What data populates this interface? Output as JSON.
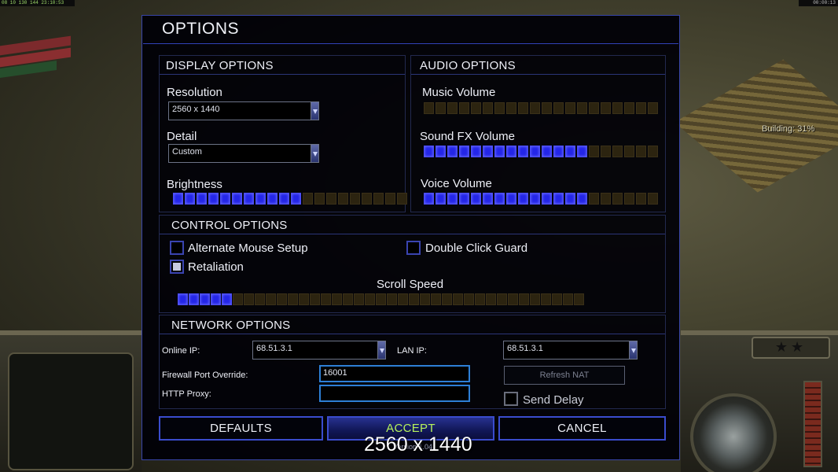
{
  "hud": {
    "top_left_text": "08 10 130 144 23:10:53",
    "top_right_text": "00:00:13",
    "building_text": "Building: 31%"
  },
  "dialog": {
    "title": "OPTIONS",
    "version_text": "Version 1.04"
  },
  "display": {
    "header": "DISPLAY OPTIONS",
    "resolution_label": "Resolution",
    "resolution_value": "2560 x 1440",
    "detail_label": "Detail",
    "detail_value": "Custom",
    "brightness_label": "Brightness",
    "brightness_level": 11,
    "brightness_segments": 20
  },
  "audio": {
    "header": "AUDIO OPTIONS",
    "music_label": "Music Volume",
    "music_level": 0,
    "music_segments": 20,
    "sfx_label": "Sound FX Volume",
    "sfx_level": 14,
    "sfx_segments": 20,
    "voice_label": "Voice Volume",
    "voice_level": 14,
    "voice_segments": 20
  },
  "control": {
    "header": "CONTROL OPTIONS",
    "alt_mouse_label": "Alternate Mouse Setup",
    "alt_mouse_checked": false,
    "double_click_label": "Double Click Guard",
    "double_click_checked": false,
    "retaliation_label": "Retaliation",
    "retaliation_checked": true,
    "scroll_label": "Scroll Speed",
    "scroll_level": 5,
    "scroll_segments": 37
  },
  "network": {
    "header": "NETWORK OPTIONS",
    "online_ip_label": "Online IP:",
    "online_ip_value": "68.51.3.1",
    "lan_ip_label": "LAN IP:",
    "lan_ip_value": "68.51.3.1",
    "firewall_label": "Firewall Port Override:",
    "firewall_value": "16001",
    "proxy_label": "HTTP Proxy:",
    "proxy_value": "",
    "refresh_nat_label": "Refresh NAT",
    "send_delay_label": "Send Delay",
    "send_delay_checked": false
  },
  "buttons": {
    "defaults": "DEFAULTS",
    "accept": "ACCEPT",
    "cancel": "CANCEL"
  },
  "overlay": {
    "resolution_text": "2560 x 1440"
  },
  "colors": {
    "accent_blue": "#2426e8",
    "accept_text": "#b6f25c",
    "segment_off": "#2c2410"
  }
}
